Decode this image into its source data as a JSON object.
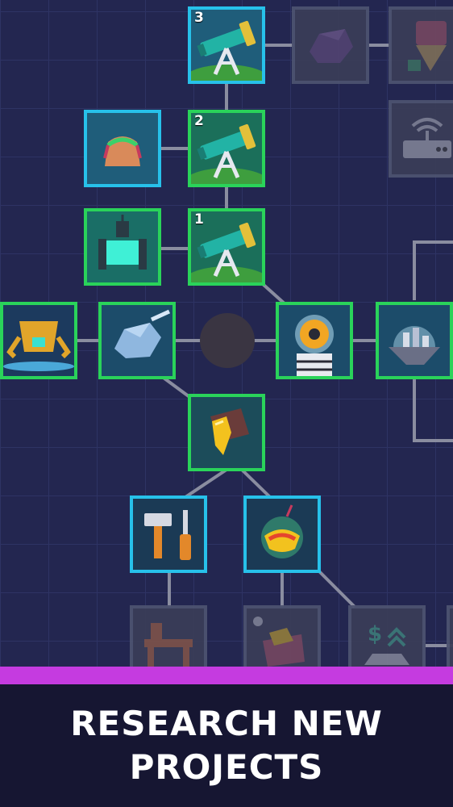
{
  "banner": {
    "line1": "RESEARCH NEW",
    "line2": "PROJECTS"
  },
  "telescope_levels": {
    "level_3": "3",
    "level_2": "2",
    "level_1": "1"
  },
  "colors": {
    "background": "#232650",
    "grid": "#2e3364",
    "researched_border": "#2ad35a",
    "available_border": "#27c1ea",
    "locked_border": "#4d5370",
    "banner_stripe": "#c53be0",
    "banner_bg": "#161632"
  },
  "nodes": [
    {
      "name": "telescope-level-3",
      "icon": "telescope-icon",
      "state": "available"
    },
    {
      "name": "asteroid-rock",
      "icon": "asteroid-icon",
      "state": "locked"
    },
    {
      "name": "drill",
      "icon": "drill-icon",
      "state": "locked"
    },
    {
      "name": "cargo-bag",
      "icon": "bag-icon",
      "state": "available"
    },
    {
      "name": "telescope-level-2",
      "icon": "telescope-icon",
      "state": "researched"
    },
    {
      "name": "router",
      "icon": "wifi-router-icon",
      "state": "locked"
    },
    {
      "name": "teleporter-machine",
      "icon": "machine-icon",
      "state": "researched"
    },
    {
      "name": "telescope-level-1",
      "icon": "telescope-icon",
      "state": "researched"
    },
    {
      "name": "mining-robot",
      "icon": "robot-icon",
      "state": "researched"
    },
    {
      "name": "ice-asteroid",
      "icon": "ice-asteroid-icon",
      "state": "researched"
    },
    {
      "name": "astronaut",
      "icon": "astronaut-icon",
      "state": "researched"
    },
    {
      "name": "floating-city",
      "icon": "city-dome-icon",
      "state": "researched"
    },
    {
      "name": "gold-ore",
      "icon": "gold-ore-icon",
      "state": "researched"
    },
    {
      "name": "hammer-screwdriver",
      "icon": "tools-icon",
      "state": "available"
    },
    {
      "name": "lava-orb",
      "icon": "lava-orb-icon",
      "state": "available"
    },
    {
      "name": "workbench",
      "icon": "workbench-icon",
      "state": "locked"
    },
    {
      "name": "ore-cart",
      "icon": "cart-icon",
      "state": "locked"
    },
    {
      "name": "money-ingot",
      "icon": "money-icon",
      "state": "locked"
    }
  ]
}
